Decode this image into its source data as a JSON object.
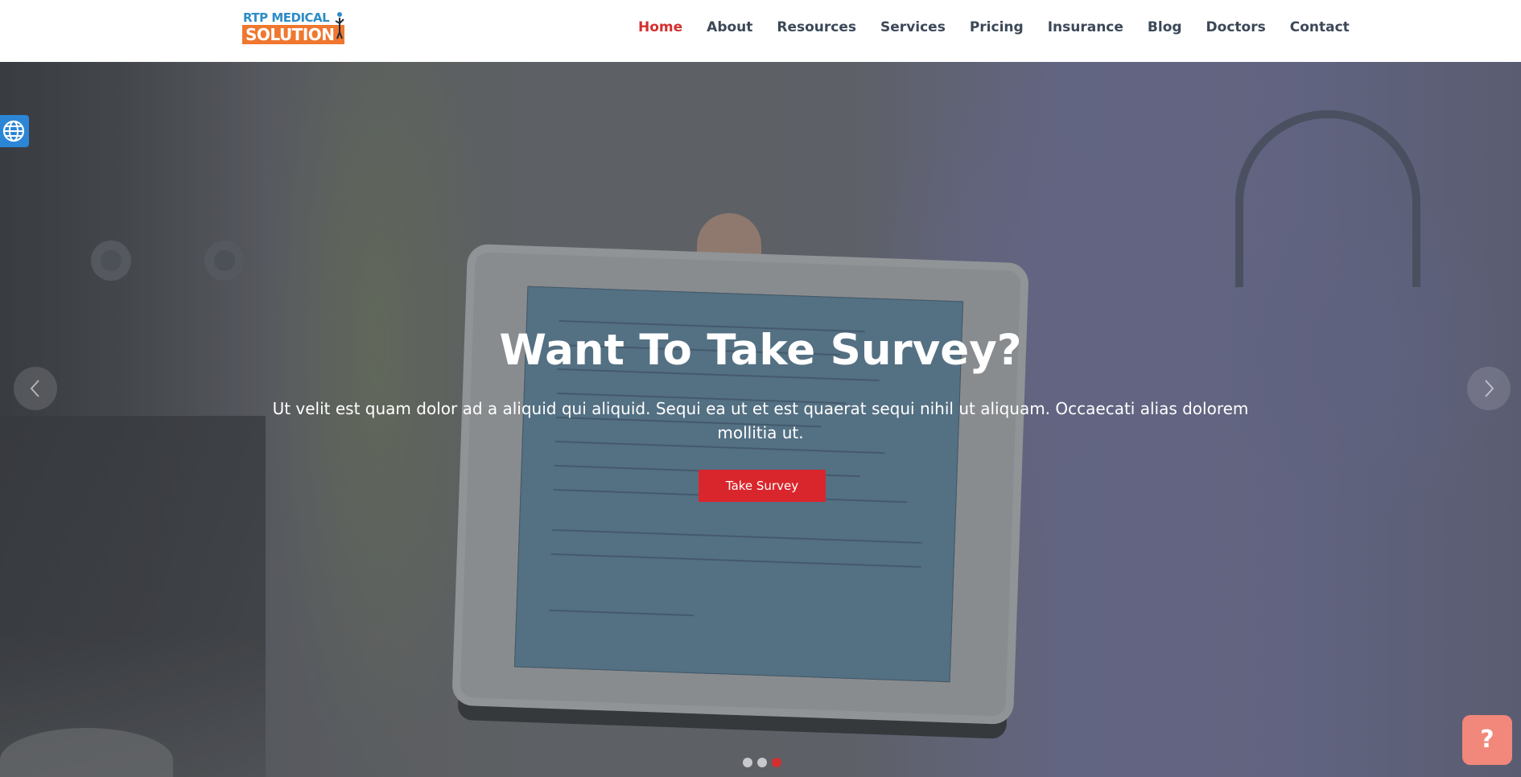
{
  "logo": {
    "top": "RTP MEDICAL",
    "bottom": "SOLUTION"
  },
  "nav": {
    "items": [
      {
        "label": "Home",
        "active": true
      },
      {
        "label": "About"
      },
      {
        "label": "Resources"
      },
      {
        "label": "Services"
      },
      {
        "label": "Pricing"
      },
      {
        "label": "Insurance"
      },
      {
        "label": "Blog"
      },
      {
        "label": "Doctors"
      },
      {
        "label": "Contact"
      }
    ]
  },
  "hero": {
    "title": "Want To Take Survey?",
    "text": "Ut velit est quam dolor ad a aliquid qui aliquid. Sequi ea ut et est quaerat sequi nihil ut aliquam. Occaecati alias dolorem mollitia ut.",
    "button": "Take Survey",
    "slides": 3,
    "active_slide": 3
  },
  "widgets": {
    "language_icon": "globe-icon",
    "help_label": "?"
  },
  "colors": {
    "accent": "#d9262c",
    "nav_text": "#3c4858",
    "logo_blue": "#2d8cc8",
    "logo_orange": "#f0772f",
    "language_button": "#2b86d6",
    "help_button": "#f2877b"
  }
}
